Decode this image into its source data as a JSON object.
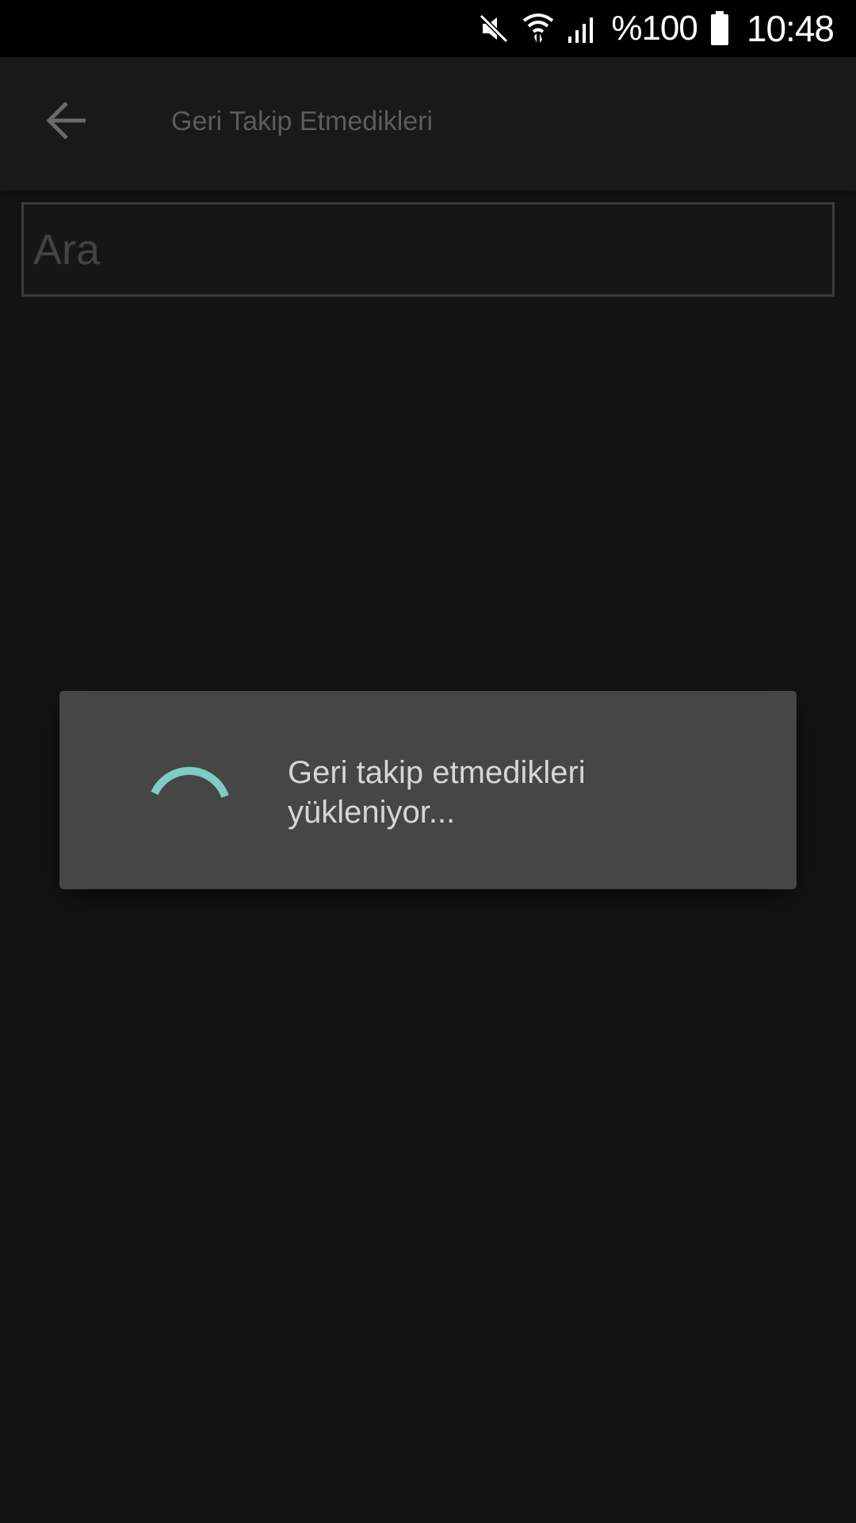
{
  "status_bar": {
    "battery_text": "%100",
    "time": "10:48",
    "icons": [
      "mute-icon",
      "wifi-icon",
      "signal-icon",
      "battery-icon"
    ]
  },
  "app_bar": {
    "title": "Geri Takip Etmedikleri",
    "back_icon": "arrow-back-icon"
  },
  "search": {
    "placeholder": "Ara",
    "value": ""
  },
  "dialog": {
    "message": "Geri takip etmedikleri yükleniyor...",
    "spinner_color": "#80cbc4"
  },
  "colors": {
    "background": "#141414",
    "app_bar": "#191919",
    "dialog": "#464646",
    "accent": "#80cbc4"
  }
}
